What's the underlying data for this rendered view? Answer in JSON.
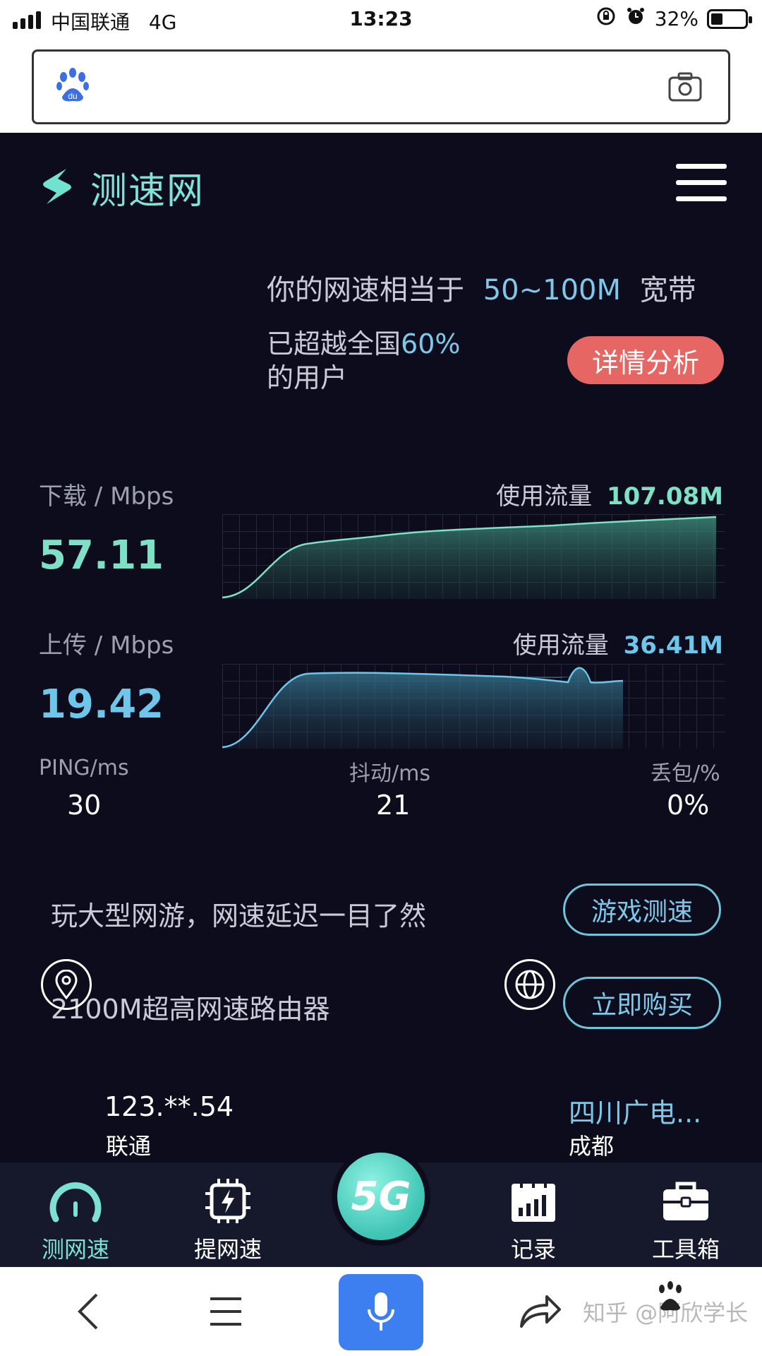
{
  "status_bar": {
    "carrier": "中国联通",
    "network": "4G",
    "time": "13:23",
    "battery": "32%"
  },
  "header": {
    "logo_text": "测速网"
  },
  "result": {
    "equivalent_prefix": "你的网速相当于",
    "equivalent_value": "50~100M",
    "equivalent_suffix": "宽带",
    "beyond_prefix": "已超越全国",
    "beyond_value": "60%",
    "beyond_suffix": "的用户",
    "detail_button": "详情分析"
  },
  "download": {
    "label": "下载 / Mbps",
    "value": "57.11",
    "usage_label": "使用流量",
    "usage_value": "107.08M",
    "color": "#7ee0c4"
  },
  "upload": {
    "label": "上传 / Mbps",
    "value": "19.42",
    "usage_label": "使用流量",
    "usage_value": "36.41M",
    "color": "#6ec6ea"
  },
  "metrics": {
    "ping_label": "PING/ms",
    "ping_value": "30",
    "jitter_label": "抖动/ms",
    "jitter_value": "21",
    "loss_label": "丢包/%",
    "loss_value": "0%"
  },
  "promos": [
    {
      "text": "玩大型网游，网速延迟一目了然",
      "button": "游戏测速"
    },
    {
      "text": "2100M超高网速路由器",
      "button": "立即购买"
    }
  ],
  "connection": {
    "ip": "123.**.54",
    "ip_isp": "联通",
    "provider": "四川广电...",
    "city": "成都"
  },
  "tabs": [
    {
      "label": "测网速",
      "icon": "speedometer-icon",
      "active": true
    },
    {
      "label": "提网速",
      "icon": "chip-bolt-icon",
      "active": false
    },
    {
      "label": "5G",
      "icon": "5g-icon",
      "active": false
    },
    {
      "label": "记录",
      "icon": "calendar-chart-icon",
      "active": false
    },
    {
      "label": "工具箱",
      "icon": "toolbox-icon",
      "active": false
    }
  ],
  "browser_bar": {
    "watermark": "知乎 @阿欣学长"
  },
  "colors": {
    "accent_teal": "#7ee0d3",
    "accent_blue": "#7ec9e9",
    "button_red": "#e56663",
    "background": "#0c0c1c"
  }
}
